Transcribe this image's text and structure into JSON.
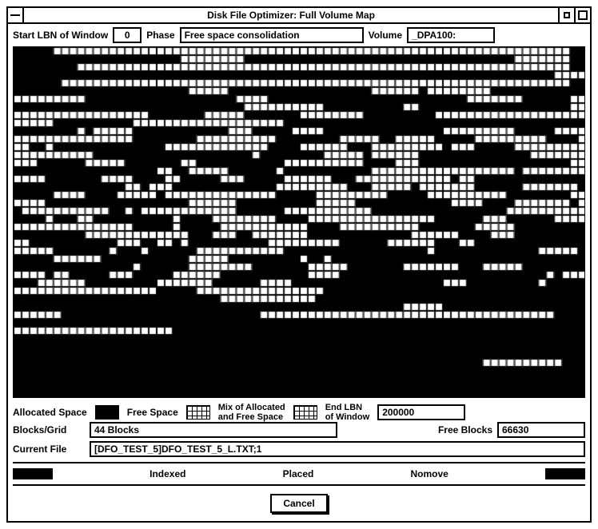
{
  "window": {
    "title": "Disk File Optimizer: Full Volume Map"
  },
  "header": {
    "start_lbn_label": "Start LBN of Window",
    "start_lbn_value": "0",
    "phase_label": "Phase",
    "phase_value": "Free space consolidation",
    "volume_label": "Volume",
    "volume_value": "_DPA100:"
  },
  "legend": {
    "allocated_label": "Allocated Space",
    "free_label": "Free Space",
    "mix_label_l1": "Mix of Allocated",
    "mix_label_l2": "and Free Space",
    "end_lbn_label_l1": "End LBN",
    "end_lbn_label_l2": "of Window",
    "end_lbn_value": "200000"
  },
  "info": {
    "blocks_grid_label": "Blocks/Grid",
    "blocks_grid_value": "44 Blocks",
    "free_blocks_label": "Free Blocks",
    "free_blocks_value": "66630",
    "current_file_label": "Current File",
    "current_file_value": "[DFO_TEST_5]DFO_TEST_5_L.TXT;1"
  },
  "status": {
    "indexed": "Indexed",
    "placed": "Placed",
    "nomove": "Nomove"
  },
  "buttons": {
    "cancel": "Cancel"
  },
  "volume_map": {
    "cols": 72,
    "rows": 44,
    "seed": 1234567,
    "comment": "Block-state map rendered procedurally to approximate the dense allocation pattern: black=allocated, white-grid=free."
  }
}
